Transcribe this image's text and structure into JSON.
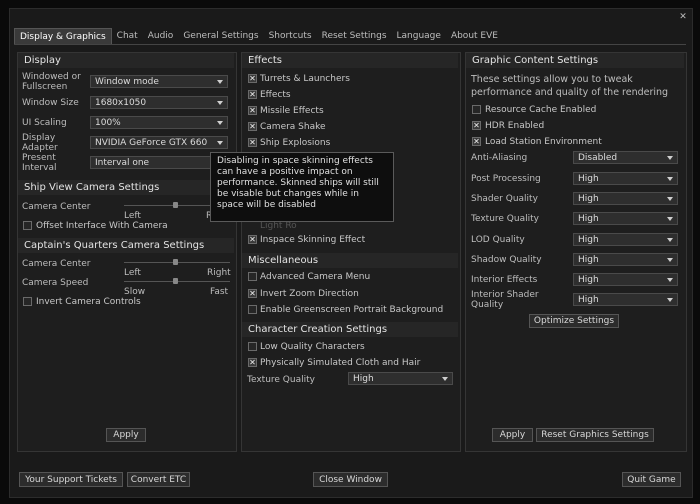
{
  "tabs": [
    "Display & Graphics",
    "Chat",
    "Audio",
    "General Settings",
    "Shortcuts",
    "Reset Settings",
    "Language",
    "About EVE"
  ],
  "display": {
    "title": "Display",
    "windowed_label": "Windowed or Fullscreen",
    "windowed_value": "Window mode",
    "window_size_label": "Window Size",
    "window_size_value": "1680x1050",
    "ui_scaling_label": "UI Scaling",
    "ui_scaling_value": "100%",
    "display_adapter_label": "Display Adapter",
    "display_adapter_value": "NVIDIA GeForce GTX 660",
    "present_interval_label": "Present Interval",
    "present_interval_value": "Interval one"
  },
  "ship_camera": {
    "title": "Ship View Camera Settings",
    "camera_center": "Camera Center",
    "left": "Left",
    "right_partial": "R",
    "offset_label": "Offset Interface With Camera"
  },
  "captain_camera": {
    "title": "Captain's Quarters Camera Settings",
    "camera_center": "Camera Center",
    "left": "Left",
    "right": "Right",
    "camera_speed": "Camera Speed",
    "slow": "Slow",
    "fast": "Fast",
    "invert_label": "Invert Camera Controls",
    "apply": "Apply"
  },
  "effects": {
    "title": "Effects",
    "items": [
      "Turrets & Launchers",
      "Effects",
      "Missile Effects",
      "Camera Shake",
      "Ship Explosions"
    ],
    "hidden_partial": "Light Ro",
    "inspace_skinning": "Inspace Skinning Effect"
  },
  "misc": {
    "title": "Miscellaneous",
    "advanced_camera": "Advanced Camera Menu",
    "invert_zoom": "Invert Zoom Direction",
    "greenscreen": "Enable Greenscreen Portrait Background"
  },
  "char_creation": {
    "title": "Character Creation Settings",
    "low_quality": "Low Quality Characters",
    "cloth": "Physically Simulated Cloth and Hair",
    "texture_label": "Texture Quality",
    "texture_value": "High"
  },
  "graphic_content": {
    "title": "Graphic Content Settings",
    "desc": "These settings allow you to tweak performance and quality of the rendering",
    "resource_cache": "Resource Cache Enabled",
    "hdr": "HDR Enabled",
    "load_station": "Load Station Environment",
    "anti_aliasing_label": "Anti-Aliasing",
    "anti_aliasing_value": "Disabled",
    "post_processing_label": "Post Processing",
    "shader_label": "Shader Quality",
    "texture_label": "Texture Quality",
    "lod_label": "LOD Quality",
    "shadow_label": "Shadow Quality",
    "interior_effects_label": "Interior Effects",
    "interior_shader_label": "Interior Shader Quality",
    "high": "High",
    "optimize": "Optimize Settings",
    "apply": "Apply",
    "reset": "Reset Graphics Settings"
  },
  "tooltip": "Disabling in space skinning effects can have a positive impact on performance. Skinned ships will still be visable but changes while in space will be disabled",
  "footer": {
    "support": "Your Support Tickets",
    "convert": "Convert ETC",
    "close": "Close Window",
    "quit": "Quit Game"
  }
}
